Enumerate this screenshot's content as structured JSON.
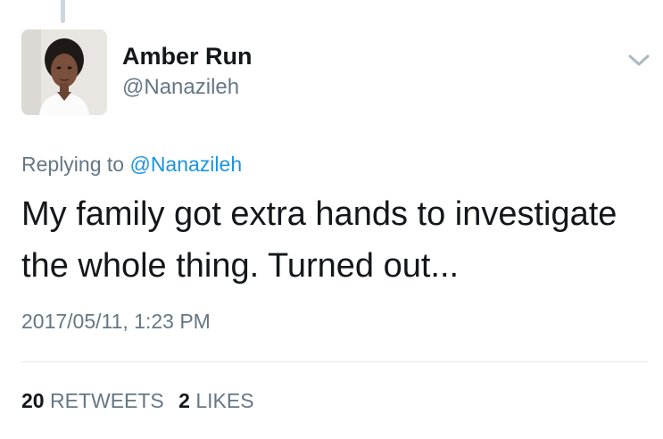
{
  "author": {
    "name": "Amber Run",
    "handle": "@Nanazileh"
  },
  "reply": {
    "prefix": "Replying to",
    "mention": "@Nanazileh"
  },
  "tweet": {
    "text": "My family got extra hands to investigate the whole thing. Turned out...",
    "timestamp": "2017/05/11, 1:23 PM"
  },
  "stats": {
    "retweets_count": "20",
    "retweets_label": "RETWEETS",
    "likes_count": "2",
    "likes_label": "LIKES"
  },
  "icons": {
    "menu": "chevron-down-icon"
  },
  "colors": {
    "link": "#1b95e0",
    "secondary_text": "#657786",
    "primary_text": "#14171a",
    "divider": "#e1e8ed"
  }
}
